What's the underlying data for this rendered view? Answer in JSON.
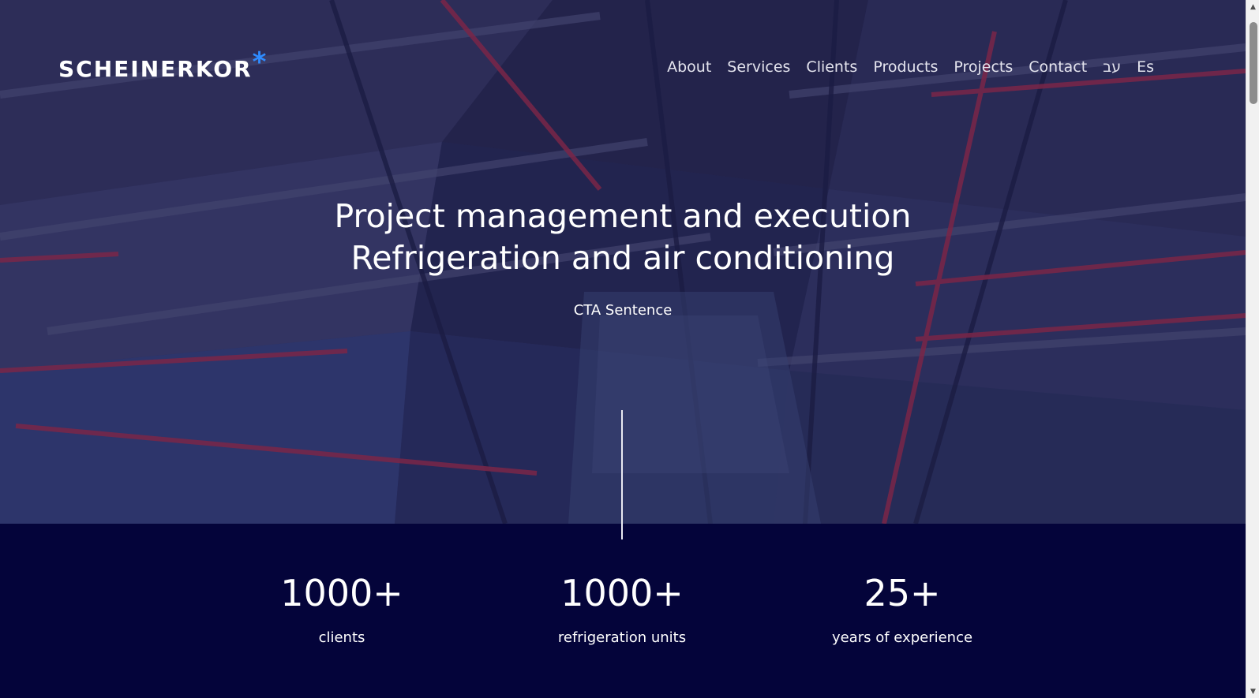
{
  "header": {
    "logo_text": "SCHEINERKOR",
    "logo_mark": "*",
    "nav": [
      {
        "label": "About"
      },
      {
        "label": "Services"
      },
      {
        "label": "Clients"
      },
      {
        "label": "Products"
      },
      {
        "label": "Projects"
      },
      {
        "label": "Contact"
      },
      {
        "label": "עב"
      },
      {
        "label": "Es"
      }
    ]
  },
  "hero": {
    "headline_line1": "Project management and execution",
    "headline_line2": "Refrigeration and air conditioning",
    "cta": "CTA Sentence"
  },
  "stats": [
    {
      "value": "1000+",
      "label": "clients"
    },
    {
      "value": "1000+",
      "label": "refrigeration units"
    },
    {
      "value": "25+",
      "label": "years of experience"
    }
  ],
  "colors": {
    "brand_accent": "#2f8cff",
    "stats_background": "#04043a",
    "hero_pipe_red": "#b0304a"
  },
  "icons": {
    "scroll_up": "▲",
    "scroll_down": "▼"
  }
}
